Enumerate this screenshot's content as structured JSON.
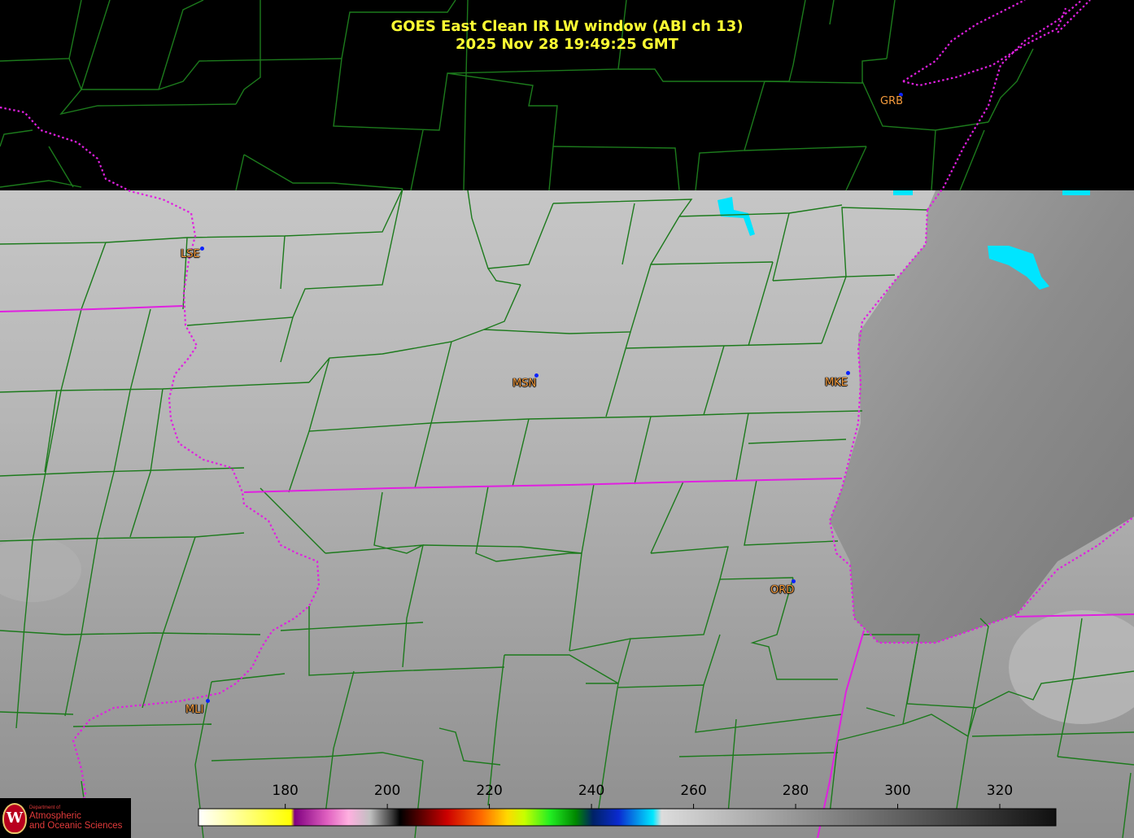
{
  "title": {
    "line1": "GOES East Clean IR LW window (ABI ch 13)",
    "line2": "2025 Nov 28  19:49:25 GMT"
  },
  "stations": [
    {
      "code": "GRB"
    },
    {
      "code": "LSE"
    },
    {
      "code": "MSN"
    },
    {
      "code": "MKE"
    },
    {
      "code": "ORD"
    },
    {
      "code": "MLI"
    }
  ],
  "colorbar": {
    "ticks": [
      "180",
      "200",
      "220",
      "240",
      "260",
      "280",
      "300",
      "320"
    ],
    "tick_values": [
      180,
      200,
      220,
      240,
      260,
      280,
      300,
      320
    ],
    "min": 163,
    "max": 331
  },
  "logo": {
    "dept": "Department of",
    "line1": "Atmospheric",
    "line2": "and Oceanic Sciences",
    "seal": "W"
  },
  "colors": {
    "background": "#000000",
    "county_lines": "#1c7a1c",
    "state_lines": "#e020e0",
    "title": "#ffff33",
    "station_label": "#f39a3c",
    "station_dot": "#0a22ff",
    "cold_cloud": "#00e5ff"
  }
}
